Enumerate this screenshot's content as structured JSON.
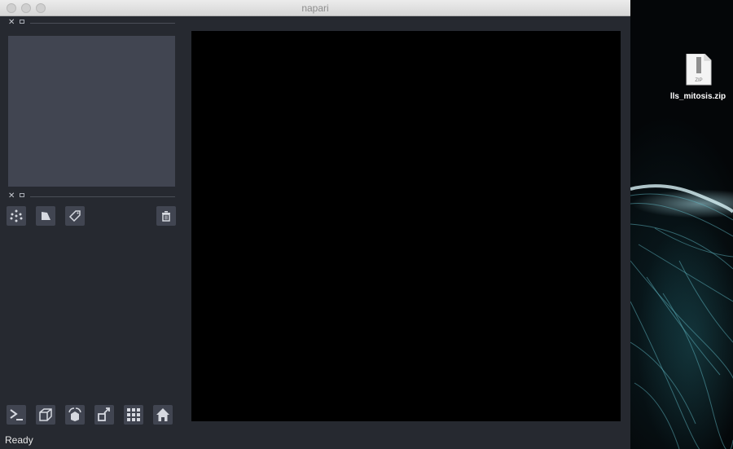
{
  "window": {
    "title": "napari"
  },
  "status": {
    "text": "Ready"
  },
  "layer_controls_toolbar": {
    "buttons": [
      "new-points-layer",
      "new-shapes-layer",
      "new-labels-layer",
      "delete-layer"
    ]
  },
  "viewer_buttons": {
    "buttons": [
      "console",
      "ndisplay-toggle",
      "roll-dimensions",
      "transpose-dimensions",
      "grid-view",
      "reset-view"
    ]
  },
  "desktop": {
    "file_icon_badge": "ZIP",
    "file_name": "lls_mitosis.zip"
  },
  "colors": {
    "panel": "#262930",
    "widget": "#414551",
    "canvas": "#000000",
    "icon": "#d6d9e0"
  }
}
